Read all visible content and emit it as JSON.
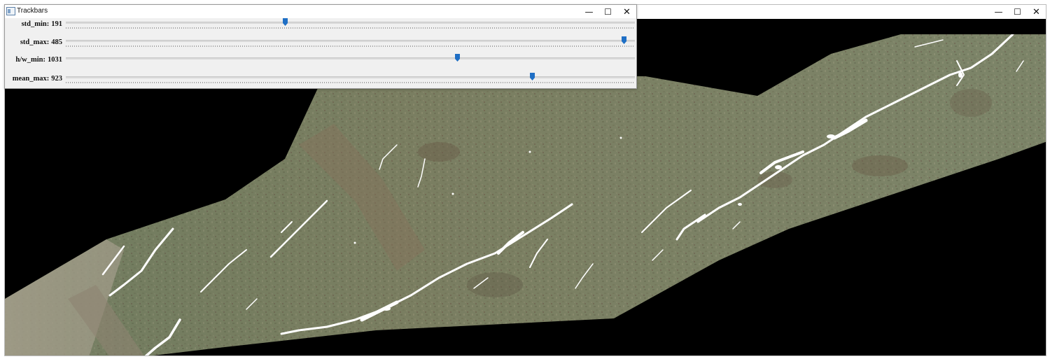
{
  "trackbars_window": {
    "title": "Trackbars",
    "buttons": {
      "minimize": "—",
      "maximize": "☐",
      "close": "✕"
    },
    "sliders": [
      {
        "label": "std_min:",
        "value": "191",
        "fraction": 0.384
      },
      {
        "label": "std_max:",
        "value": "485",
        "fraction": 0.985
      },
      {
        "label": "h/w_min:",
        "value": "1031",
        "fraction": 0.69
      },
      {
        "label": "mean_max:",
        "value": "923",
        "fraction": 0.822
      }
    ]
  },
  "image_window": {
    "buttons": {
      "minimize": "—",
      "maximize": "☐",
      "close": "✕"
    }
  },
  "colors": {
    "terrain": "#7b8466",
    "terrain_dark": "#6b7257",
    "terrain_brown": "#8a7a5e",
    "crack": "#ffffff",
    "slider_thumb": "#1f6fc5",
    "background": "#000000"
  }
}
